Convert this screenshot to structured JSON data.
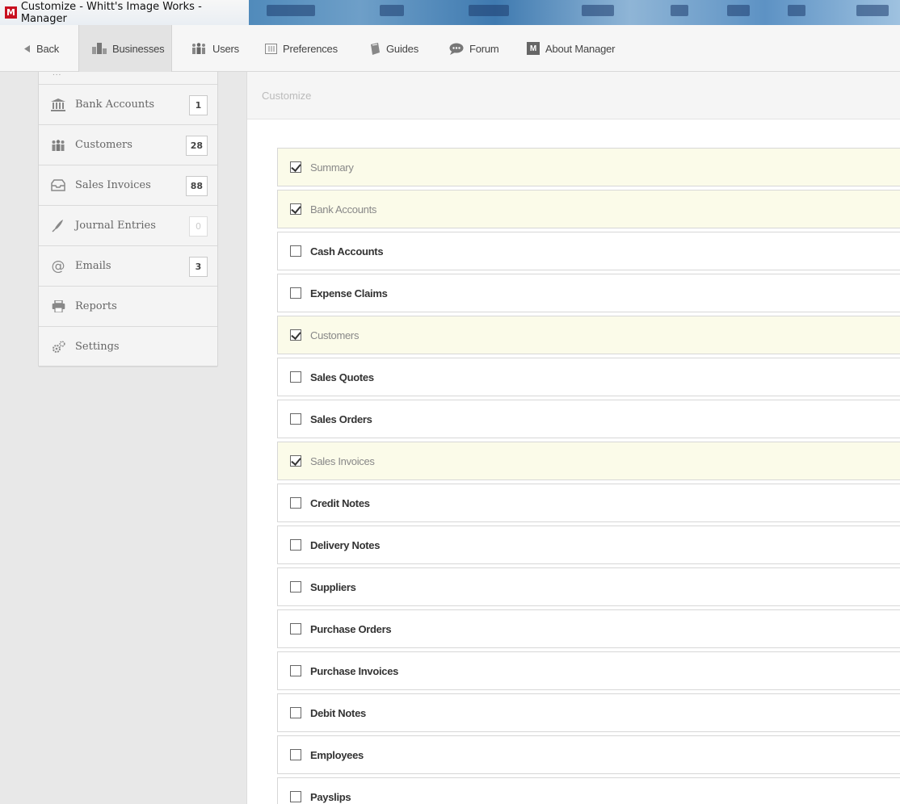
{
  "window": {
    "app_icon_letter": "M",
    "title": "Customize - Whitt's Image Works - Manager"
  },
  "toolbar": {
    "items": [
      {
        "label": "Back",
        "icon": "triangle-left-icon"
      },
      {
        "label": "Businesses",
        "icon": "businesses-icon",
        "active": true
      },
      {
        "label": "Users",
        "icon": "users-icon"
      },
      {
        "label": "Preferences",
        "icon": "preferences-icon"
      },
      {
        "label": "Guides",
        "icon": "guides-icon"
      },
      {
        "label": "Forum",
        "icon": "forum-icon"
      },
      {
        "label": "About Manager",
        "icon": "manager-logo-icon",
        "icon_letter": "M"
      }
    ]
  },
  "sidebar": {
    "top_dots": "...",
    "items": [
      {
        "label": "Bank Accounts",
        "icon": "bank-icon",
        "count": "1"
      },
      {
        "label": "Customers",
        "icon": "customers-icon",
        "count": "28"
      },
      {
        "label": "Sales Invoices",
        "icon": "sales-invoices-icon",
        "count": "88"
      },
      {
        "label": "Journal Entries",
        "icon": "journal-icon",
        "count": "0"
      },
      {
        "label": "Emails",
        "icon": "at-icon",
        "count": "3"
      },
      {
        "label": "Reports",
        "icon": "printer-icon"
      },
      {
        "label": "Settings",
        "icon": "gears-icon"
      }
    ]
  },
  "main": {
    "header": "Customize",
    "options": [
      {
        "label": "Summary",
        "checked": true
      },
      {
        "label": "Bank Accounts",
        "checked": true
      },
      {
        "label": "Cash Accounts",
        "checked": false
      },
      {
        "label": "Expense Claims",
        "checked": false
      },
      {
        "label": "Customers",
        "checked": true
      },
      {
        "label": "Sales Quotes",
        "checked": false
      },
      {
        "label": "Sales Orders",
        "checked": false
      },
      {
        "label": "Sales Invoices",
        "checked": true
      },
      {
        "label": "Credit Notes",
        "checked": false
      },
      {
        "label": "Delivery Notes",
        "checked": false
      },
      {
        "label": "Suppliers",
        "checked": false
      },
      {
        "label": "Purchase Orders",
        "checked": false
      },
      {
        "label": "Purchase Invoices",
        "checked": false
      },
      {
        "label": "Debit Notes",
        "checked": false
      },
      {
        "label": "Employees",
        "checked": false
      },
      {
        "label": "Payslips",
        "checked": false
      }
    ]
  }
}
